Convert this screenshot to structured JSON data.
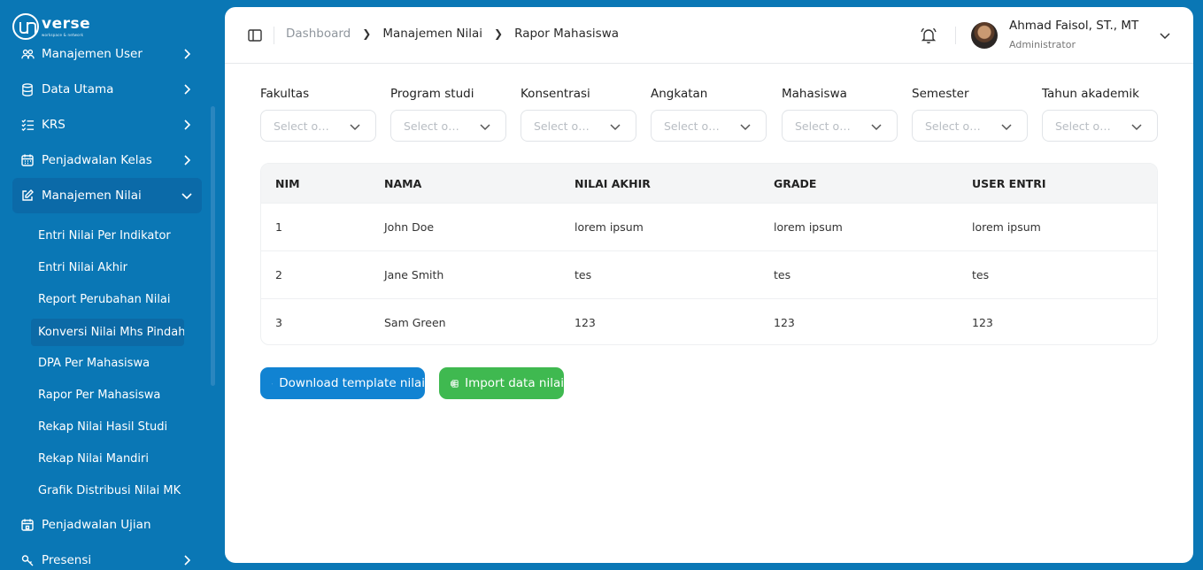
{
  "sidebar": {
    "logo": {
      "word": "verse",
      "tagline": "workspace & network"
    },
    "items": [
      {
        "label": "Manajemen User",
        "icon": "users-icon"
      },
      {
        "label": "Data Utama",
        "icon": "database-icon"
      },
      {
        "label": "KRS",
        "icon": "list-check-icon"
      },
      {
        "label": "Penjadwalan Kelas",
        "icon": "calendar-icon"
      },
      {
        "label": "Manajemen Nilai",
        "icon": "edit-icon",
        "expanded": true
      },
      {
        "label": "Penjadwalan Ujian",
        "icon": "calendar-icon"
      },
      {
        "label": "Presensi",
        "icon": "key-icon"
      }
    ],
    "subitems": [
      {
        "label": "Entri Nilai Per Indikator"
      },
      {
        "label": "Entri Nilai Akhir"
      },
      {
        "label": "Report Perubahan Nilai"
      },
      {
        "label": "Konversi Nilai Mhs Pindahan",
        "active": true
      },
      {
        "label": "DPA Per Mahasiswa"
      },
      {
        "label": "Rapor Per Mahasiswa"
      },
      {
        "label": "Rekap Nilai Hasil Studi"
      },
      {
        "label": "Rekap Nilai Mandiri"
      },
      {
        "label": "Grafik Distribusi Nilai MK"
      }
    ]
  },
  "header": {
    "breadcrumb": [
      "Dashboard",
      "Manajemen Nilai",
      "Rapor Mahasiswa"
    ],
    "user": {
      "name": "Ahmad Faisol, ST., MT",
      "role": "Administrator"
    }
  },
  "filters": [
    {
      "label": "Fakultas",
      "placeholder": "Select option"
    },
    {
      "label": "Program studi",
      "placeholder": "Select option"
    },
    {
      "label": "Konsentrasi",
      "placeholder": "Select option"
    },
    {
      "label": "Angkatan",
      "placeholder": "Select option"
    },
    {
      "label": "Mahasiswa",
      "placeholder": "Select option"
    },
    {
      "label": "Semester",
      "placeholder": "Select option"
    },
    {
      "label": "Tahun akademik",
      "placeholder": "Select option"
    }
  ],
  "table": {
    "headers": [
      "NIM",
      "NAMA",
      "NILAI AKHIR",
      "GRADE",
      "USER ENTRI"
    ],
    "rows": [
      [
        "1",
        "John Doe",
        "lorem ipsum",
        "lorem ipsum",
        "lorem ipsum"
      ],
      [
        "2",
        "Jane Smith",
        "tes",
        "tes",
        "tes"
      ],
      [
        "3",
        "Sam Green",
        "123",
        "123",
        "123"
      ]
    ]
  },
  "actions": {
    "download_label": "Download template nilai",
    "import_label": "Import data nilai"
  },
  "colors": {
    "sidebar_bg": "#0a77b5",
    "primary_button": "#1183d2",
    "success_button": "#3fb950"
  }
}
